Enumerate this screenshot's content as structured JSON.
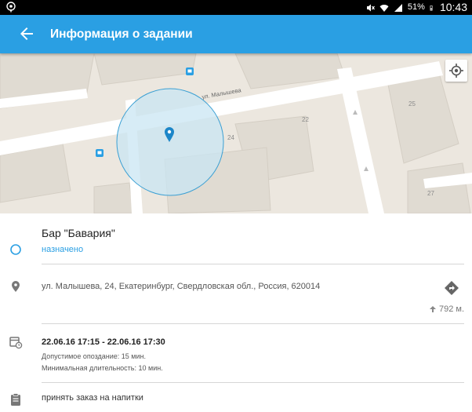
{
  "status_bar": {
    "battery": "51%",
    "time": "10:43"
  },
  "app_bar": {
    "title": "Информация о задании"
  },
  "map": {
    "street_label": "ул. Малышева",
    "house_numbers": [
      "22",
      "24",
      "25",
      "27"
    ]
  },
  "task": {
    "name": "Бар \"Бавария\"",
    "status": "назначено",
    "address": "ул. Малышева, 24, Екатеринбург, Свердловская обл., Россия, 620014",
    "distance": "792 м.",
    "time_range": "22.06.16 17:15 - 22.06.16 17:30",
    "allowed_delay": "Допустимое опоздание: 15 мин.",
    "min_duration": "Минимальная длительность: 10 мин.",
    "note": "принять заказ на напитки"
  },
  "colors": {
    "accent": "#2a9fe3",
    "map_background": "#ece7df",
    "road": "#ffffff",
    "geofence_fill": "#c9e6f3"
  }
}
